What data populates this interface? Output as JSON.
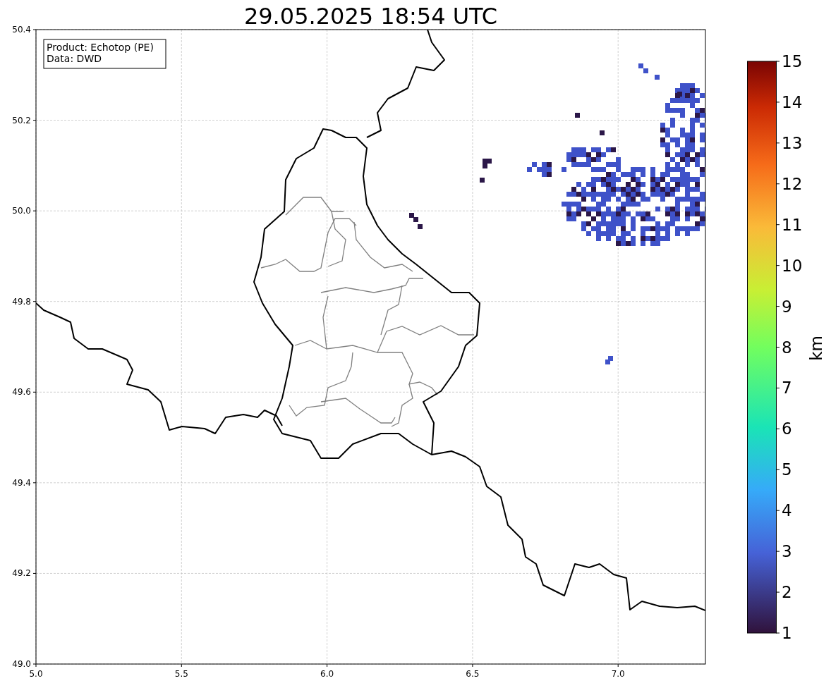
{
  "title": "29.05.2025 18:54 UTC",
  "info_box": {
    "lines": [
      "Product: Echotop (PE)",
      "Data: DWD"
    ]
  },
  "axes": {
    "x_ticks": [
      "5.0",
      "5.5",
      "6.0",
      "6.5",
      "7.0"
    ],
    "y_ticks": [
      "50.4",
      "50.2",
      "50.0",
      "49.8",
      "49.6",
      "49.4",
      "49.2",
      "49.0"
    ]
  },
  "colorbar": {
    "ticks": [
      "15",
      "14",
      "13",
      "12",
      "11",
      "10",
      "9",
      "8",
      "7",
      "6",
      "5",
      "4",
      "3",
      "2",
      "1"
    ],
    "label": "km"
  }
}
